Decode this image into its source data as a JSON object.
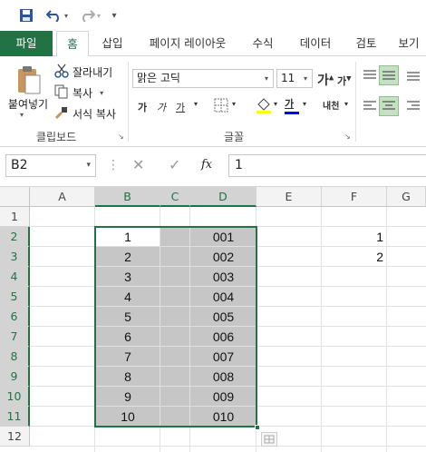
{
  "qat": {
    "save": "save-icon",
    "undo": "undo-icon",
    "redo": "redo-icon",
    "customize": "customize-icon"
  },
  "tabs": [
    {
      "label": "파일"
    },
    {
      "label": "홈"
    },
    {
      "label": "삽입"
    },
    {
      "label": "페이지 레이아웃"
    },
    {
      "label": "수식"
    },
    {
      "label": "데이터"
    },
    {
      "label": "검토"
    },
    {
      "label": "보기"
    }
  ],
  "clipboard": {
    "paste": "붙여넣기",
    "cut": "잘라내기",
    "copy": "복사",
    "format_painter": "서식 복사",
    "group": "클립보드"
  },
  "font": {
    "name": "맑은 고딕",
    "size": "11",
    "grow": "가",
    "shrink": "가",
    "bold": "가",
    "italic": "가",
    "underline": "가",
    "font_color": "가",
    "phonetic": "내천",
    "group": "글꼴"
  },
  "formula_bar": {
    "name_box": "B2",
    "fx": "fx",
    "value": "1"
  },
  "columns": [
    "A",
    "B",
    "C",
    "D",
    "E",
    "F",
    "G"
  ],
  "rows": [
    "1",
    "2",
    "3",
    "4",
    "5",
    "6",
    "7",
    "8",
    "9",
    "10",
    "11",
    "12"
  ],
  "col_b": [
    "1",
    "2",
    "3",
    "4",
    "5",
    "6",
    "7",
    "8",
    "9",
    "10"
  ],
  "col_d": [
    "001",
    "002",
    "003",
    "004",
    "005",
    "006",
    "007",
    "008",
    "009",
    "010"
  ],
  "col_f": [
    "1",
    "2"
  ],
  "colors": {
    "accent": "#217346",
    "selection": "#c6c6c6"
  }
}
